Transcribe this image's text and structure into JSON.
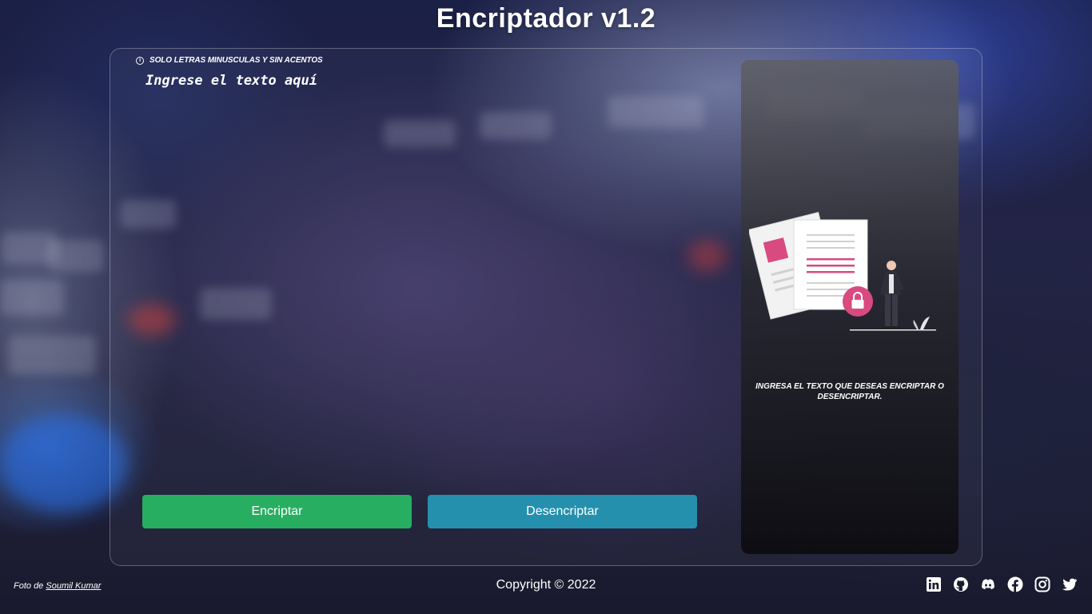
{
  "app": {
    "title": "Encriptador v1.2"
  },
  "editor": {
    "hint": "SOLO LETRAS MINUSCULAS Y SIN ACENTOS",
    "placeholder": "Ingrese el texto aquí",
    "value": ""
  },
  "buttons": {
    "encrypt_label": "Encriptar",
    "decrypt_label": "Desencriptar"
  },
  "result_panel": {
    "message": "INGRESA EL TEXTO QUE DESEAS ENCRIPTAR O DESENCRIPTAR."
  },
  "footer": {
    "photo_prefix": "Foto de",
    "photo_author": "Soumil Kumar",
    "copyright": "Copyright © 2022",
    "social_icons": [
      "linkedin-icon",
      "github-icon",
      "discord-icon",
      "facebook-icon",
      "instagram-icon",
      "twitter-icon"
    ]
  },
  "colors": {
    "encrypt_button": "#28ae60",
    "decrypt_button": "#2590ad",
    "accent_pink": "#d84a80"
  }
}
